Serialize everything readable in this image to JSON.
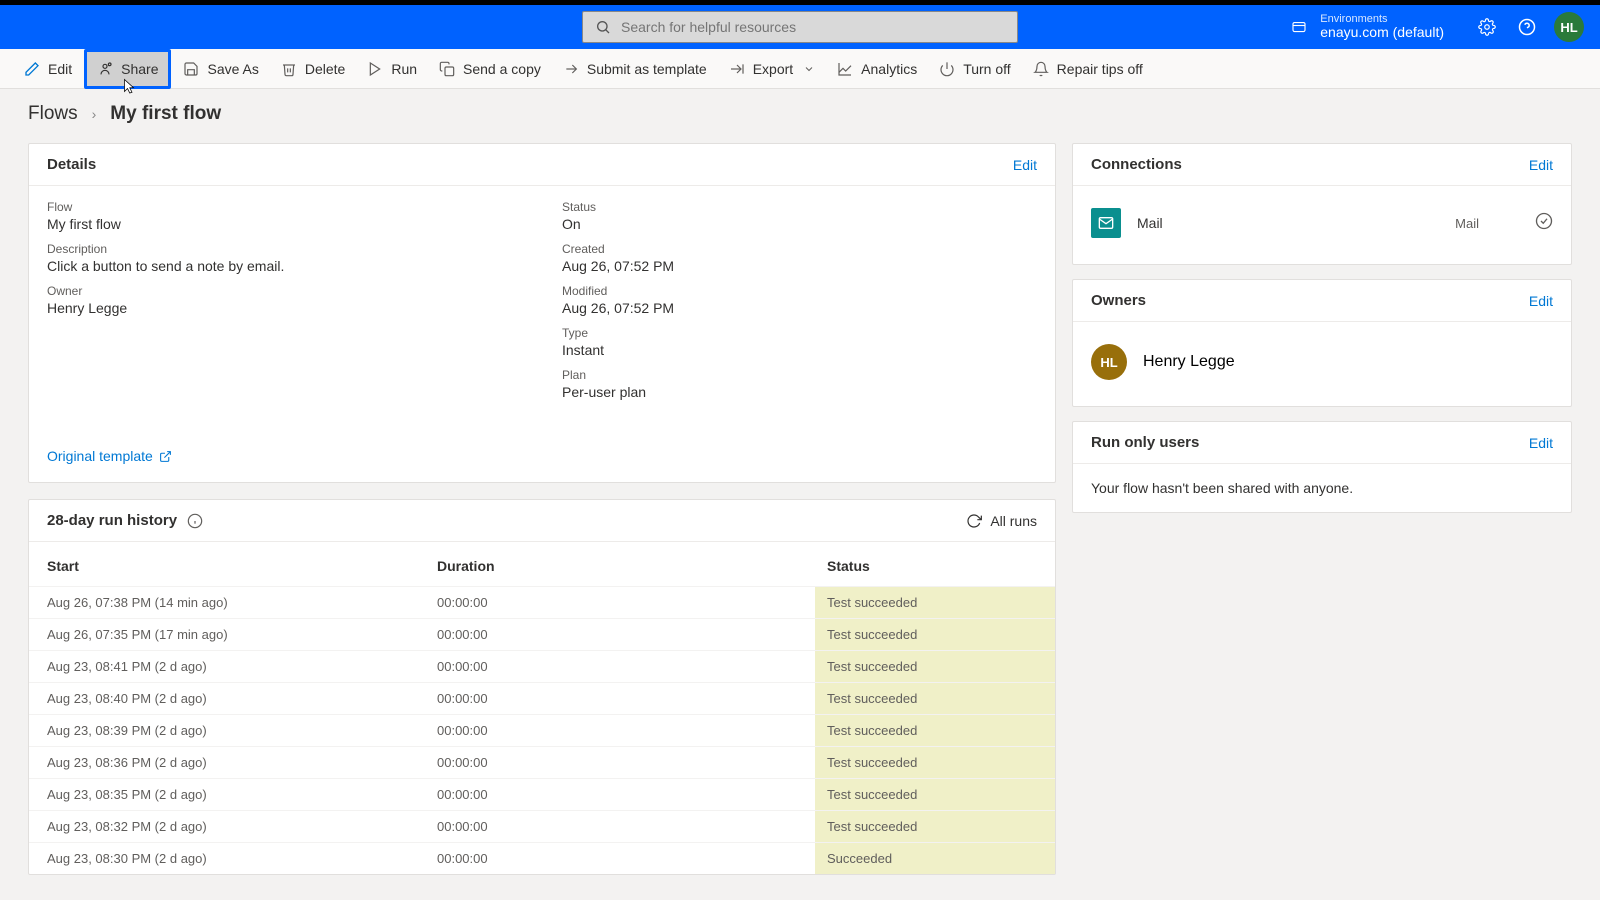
{
  "search_placeholder": "Search for helpful resources",
  "environments": {
    "label": "Environments",
    "value": "enayu.com (default)"
  },
  "avatar": "HL",
  "toolbar": {
    "edit": "Edit",
    "share": "Share",
    "saveas": "Save As",
    "delete": "Delete",
    "run": "Run",
    "sendcopy": "Send a copy",
    "submit": "Submit as template",
    "export": "Export",
    "analytics": "Analytics",
    "turnoff": "Turn off",
    "repair": "Repair tips off"
  },
  "breadcrumb": {
    "root": "Flows",
    "current": "My first flow"
  },
  "details": {
    "title": "Details",
    "edit": "Edit",
    "flow_lbl": "Flow",
    "flow_val": "My first flow",
    "status_lbl": "Status",
    "status_val": "On",
    "desc_lbl": "Description",
    "desc_val": "Click a button to send a note by email.",
    "created_lbl": "Created",
    "created_val": "Aug 26, 07:52 PM",
    "owner_lbl": "Owner",
    "owner_val": "Henry Legge",
    "modified_lbl": "Modified",
    "modified_val": "Aug 26, 07:52 PM",
    "type_lbl": "Type",
    "type_val": "Instant",
    "plan_lbl": "Plan",
    "plan_val": "Per-user plan",
    "orig": "Original template"
  },
  "connections": {
    "title": "Connections",
    "edit": "Edit",
    "item": {
      "name": "Mail",
      "secondary": "Mail"
    }
  },
  "owners": {
    "title": "Owners",
    "edit": "Edit",
    "initials": "HL",
    "name": "Henry Legge"
  },
  "runonly": {
    "title": "Run only users",
    "edit": "Edit",
    "body": "Your flow hasn't been shared with anyone."
  },
  "history": {
    "title": "28-day run history",
    "allruns": "All runs",
    "cols": {
      "start": "Start",
      "duration": "Duration",
      "status": "Status"
    },
    "rows": [
      {
        "start": "Aug 26, 07:38 PM (14 min ago)",
        "duration": "00:00:00",
        "status": "Test succeeded"
      },
      {
        "start": "Aug 26, 07:35 PM (17 min ago)",
        "duration": "00:00:00",
        "status": "Test succeeded"
      },
      {
        "start": "Aug 23, 08:41 PM (2 d ago)",
        "duration": "00:00:00",
        "status": "Test succeeded"
      },
      {
        "start": "Aug 23, 08:40 PM (2 d ago)",
        "duration": "00:00:00",
        "status": "Test succeeded"
      },
      {
        "start": "Aug 23, 08:39 PM (2 d ago)",
        "duration": "00:00:00",
        "status": "Test succeeded"
      },
      {
        "start": "Aug 23, 08:36 PM (2 d ago)",
        "duration": "00:00:00",
        "status": "Test succeeded"
      },
      {
        "start": "Aug 23, 08:35 PM (2 d ago)",
        "duration": "00:00:00",
        "status": "Test succeeded"
      },
      {
        "start": "Aug 23, 08:32 PM (2 d ago)",
        "duration": "00:00:00",
        "status": "Test succeeded"
      },
      {
        "start": "Aug 23, 08:30 PM (2 d ago)",
        "duration": "00:00:00",
        "status": "Succeeded"
      }
    ]
  }
}
